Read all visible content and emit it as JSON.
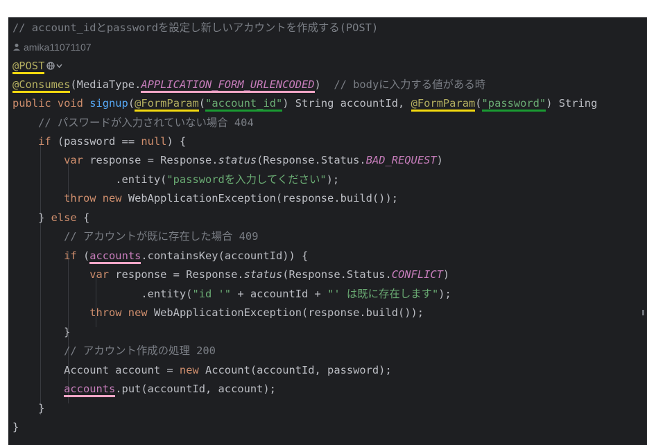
{
  "editor": {
    "author": "amika11071107",
    "lines": [
      {
        "id": "comment-header",
        "segs": [
          {
            "t": "// account_idとpasswordを設定し新しいアカウントを作成する(POST)",
            "c": "comment"
          }
        ]
      },
      {
        "id": "post",
        "segs": [
          {
            "t": "@POST",
            "c": "ann",
            "u": "yellow"
          }
        ]
      },
      {
        "id": "consumes",
        "segs": [
          {
            "t": "@Consumes",
            "c": "ann",
            "u": "yellow"
          },
          {
            "t": "(MediaType.",
            "c": "default"
          },
          {
            "t": "APPLICATION_FORM_URLENCODED",
            "c": "const",
            "u": "pink"
          },
          {
            "t": ")  ",
            "c": "default"
          },
          {
            "t": "// bodyに入力する値がある時",
            "c": "comment"
          }
        ]
      },
      {
        "id": "signup",
        "segs": [
          {
            "t": "public void ",
            "c": "kw"
          },
          {
            "t": "signup",
            "c": "fn"
          },
          {
            "t": "(",
            "c": "default"
          },
          {
            "t": "@FormParam",
            "c": "ann",
            "u": "yellow"
          },
          {
            "t": "(",
            "c": "default"
          },
          {
            "t": "\"account_id\"",
            "c": "str",
            "u": "green"
          },
          {
            "t": ") String accountId, ",
            "c": "default"
          },
          {
            "t": "@FormParam",
            "c": "ann",
            "u": "yellow"
          },
          {
            "t": "(",
            "c": "default"
          },
          {
            "t": "\"password\"",
            "c": "str",
            "u": "green"
          },
          {
            "t": ") String",
            "c": "default"
          }
        ]
      },
      {
        "id": "comment-404",
        "segs": [
          {
            "t": "    // パスワードが入力されていない場合 404",
            "c": "comment"
          }
        ]
      },
      {
        "id": "if-null",
        "segs": [
          {
            "t": "    ",
            "c": "default"
          },
          {
            "t": "if",
            "c": "kw"
          },
          {
            "t": " (password == ",
            "c": "default"
          },
          {
            "t": "null",
            "c": "kw"
          },
          {
            "t": ") {",
            "c": "default"
          }
        ]
      },
      {
        "id": "var-bad",
        "segs": [
          {
            "t": "        ",
            "c": "default"
          },
          {
            "t": "var",
            "c": "kw"
          },
          {
            "t": " response = Response.",
            "c": "default"
          },
          {
            "t": "status",
            "c": "italic"
          },
          {
            "t": "(Response.Status.",
            "c": "default"
          },
          {
            "t": "BAD_REQUEST",
            "c": "const"
          },
          {
            "t": ")",
            "c": "default"
          }
        ]
      },
      {
        "id": "entity-pw",
        "segs": [
          {
            "t": "                .entity(",
            "c": "default"
          },
          {
            "t": "\"passwordを入力してください\"",
            "c": "str"
          },
          {
            "t": ");",
            "c": "default"
          }
        ]
      },
      {
        "id": "throw-1",
        "segs": [
          {
            "t": "        ",
            "c": "default"
          },
          {
            "t": "throw new",
            "c": "kw"
          },
          {
            "t": " WebApplicationException(response.build());",
            "c": "default"
          }
        ]
      },
      {
        "id": "else",
        "segs": [
          {
            "t": "    } ",
            "c": "default"
          },
          {
            "t": "else",
            "c": "kw"
          },
          {
            "t": " {",
            "c": "default"
          }
        ]
      },
      {
        "id": "comment-409",
        "segs": [
          {
            "t": "        // アカウントが既に存在した場合 409",
            "c": "comment"
          }
        ]
      },
      {
        "id": "if-contains",
        "segs": [
          {
            "t": "        ",
            "c": "default"
          },
          {
            "t": "if",
            "c": "kw"
          },
          {
            "t": " (",
            "c": "default"
          },
          {
            "t": "accounts",
            "c": "field",
            "u": "pink"
          },
          {
            "t": ".containsKey(accountId)) {",
            "c": "default"
          }
        ]
      },
      {
        "id": "var-conflict",
        "segs": [
          {
            "t": "            ",
            "c": "default"
          },
          {
            "t": "var",
            "c": "kw"
          },
          {
            "t": " response = Response.",
            "c": "default"
          },
          {
            "t": "status",
            "c": "italic"
          },
          {
            "t": "(Response.Status.",
            "c": "default"
          },
          {
            "t": "CONFLICT",
            "c": "const"
          },
          {
            "t": ")",
            "c": "default"
          }
        ]
      },
      {
        "id": "entity-id",
        "segs": [
          {
            "t": "                    .entity(",
            "c": "default"
          },
          {
            "t": "\"id '\"",
            "c": "str"
          },
          {
            "t": " + accountId + ",
            "c": "default"
          },
          {
            "t": "\"' は既に存在します\"",
            "c": "str"
          },
          {
            "t": ");",
            "c": "default"
          }
        ]
      },
      {
        "id": "throw-2",
        "segs": [
          {
            "t": "            ",
            "c": "default"
          },
          {
            "t": "throw new",
            "c": "kw"
          },
          {
            "t": " WebApplicationException(response.build());",
            "c": "default"
          }
        ]
      },
      {
        "id": "close-if",
        "segs": [
          {
            "t": "        }",
            "c": "default"
          }
        ]
      },
      {
        "id": "comment-200",
        "segs": [
          {
            "t": "        // アカウント作成の処理 200",
            "c": "comment"
          }
        ]
      },
      {
        "id": "new-account",
        "segs": [
          {
            "t": "        Account account = ",
            "c": "default"
          },
          {
            "t": "new",
            "c": "kw"
          },
          {
            "t": " Account(accountId, password);",
            "c": "default"
          }
        ]
      },
      {
        "id": "accounts-put",
        "segs": [
          {
            "t": "        ",
            "c": "default"
          },
          {
            "t": "accounts",
            "c": "field",
            "u": "pink"
          },
          {
            "t": ".put(accountId, account);",
            "c": "default"
          }
        ]
      },
      {
        "id": "close-else",
        "segs": [
          {
            "t": "    }",
            "c": "default"
          }
        ]
      },
      {
        "id": "close-method",
        "segs": [
          {
            "t": "}",
            "c": "default"
          }
        ]
      }
    ]
  },
  "icons": {
    "author": "person-icon",
    "post_gutter": [
      "globe-icon",
      "chevron-down-icon"
    ]
  },
  "colors": {
    "background": "#1e1f22",
    "highlight_yellow": "#f3d90f",
    "highlight_pink": "#f2a6c7",
    "highlight_green": "#1a9b32"
  }
}
